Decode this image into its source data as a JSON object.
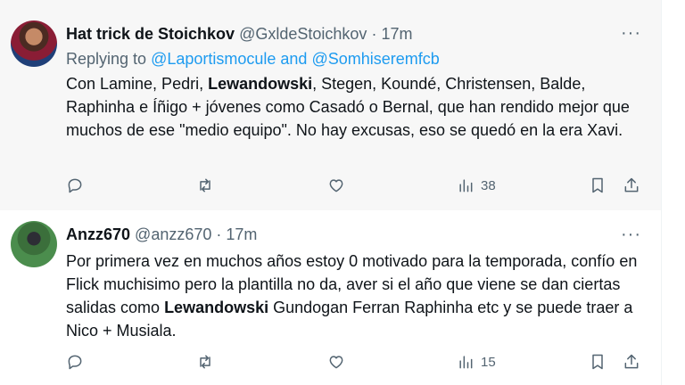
{
  "tweets": [
    {
      "author": {
        "name": "Hat trick de Stoichkov",
        "handle": "@GxldeStoichkov",
        "separator": "·",
        "time": "17m"
      },
      "reply": {
        "prefix": "Replying to",
        "users": "@Laportismocule and @Somhiseremfcb"
      },
      "text": {
        "part1": "Con Lamine, Pedri, ",
        "bold": "Lewandowski",
        "part2": ", Stegen, Koundé, Christensen, Balde, Raphinha e Íñigo + jóvenes como Casadó o Bernal, que han rendido mejor que muchos de ese \"medio equipo\". No hay excusas, eso se quedó en la era Xavi."
      },
      "more_label": "···",
      "views": "38",
      "icons": [
        "reply-icon",
        "retweet-icon",
        "like-icon",
        "views-icon",
        "bookmark-icon",
        "share-icon"
      ]
    },
    {
      "author": {
        "name": "Anzz670",
        "handle": "@anzz670",
        "separator": "·",
        "time": "17m"
      },
      "text": {
        "part1": "Por primera vez en muchos años estoy 0 motivado para la temporada, confío en Flick muchisimo pero la plantilla no da, aver si el año que viene se dan ciertas salidas como ",
        "bold": "Lewandowski",
        "part2": " Gundogan Ferran Raphinha etc y se puede traer a Nico + Musiala."
      },
      "more_label": "···",
      "views": "15",
      "icons": [
        "reply-icon",
        "retweet-icon",
        "like-icon",
        "views-icon",
        "bookmark-icon",
        "share-icon"
      ]
    }
  ],
  "colors": {
    "accent": "#1d9bf0",
    "secondary_text": "#536471",
    "primary_text": "#0f1419",
    "hover_background": "#f7f7f7"
  }
}
